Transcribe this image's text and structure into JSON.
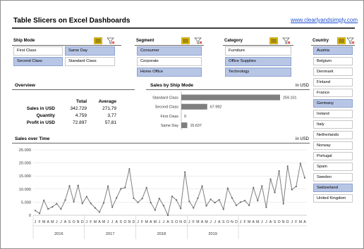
{
  "header": {
    "title": "Table Slicers on Excel Dashboards",
    "link": "www.clearlyandsimply.com"
  },
  "slicers": {
    "ship_mode": {
      "title": "Ship Mode",
      "items": [
        {
          "label": "First Class",
          "selected": false
        },
        {
          "label": "Same Day",
          "selected": true
        },
        {
          "label": "Second Class",
          "selected": true
        },
        {
          "label": "Standard Class",
          "selected": false
        }
      ]
    },
    "segment": {
      "title": "Segment",
      "items": [
        {
          "label": "Consumer",
          "selected": true
        },
        {
          "label": "Corporate",
          "selected": false
        },
        {
          "label": "Home Office",
          "selected": true
        }
      ]
    },
    "category": {
      "title": "Category",
      "items": [
        {
          "label": "Furniture",
          "selected": false
        },
        {
          "label": "Office Supplies",
          "selected": true
        },
        {
          "label": "Technology",
          "selected": true
        }
      ]
    },
    "country": {
      "title": "Country",
      "items": [
        {
          "label": "Austria",
          "selected": true
        },
        {
          "label": "Belgium",
          "selected": false
        },
        {
          "label": "Denmark",
          "selected": false
        },
        {
          "label": "Finland",
          "selected": false
        },
        {
          "label": "France",
          "selected": false
        },
        {
          "label": "Germany",
          "selected": true
        },
        {
          "label": "Ireland",
          "selected": false
        },
        {
          "label": "Italy",
          "selected": false
        },
        {
          "label": "Netherlands",
          "selected": false
        },
        {
          "label": "Norway",
          "selected": false
        },
        {
          "label": "Portugal",
          "selected": false
        },
        {
          "label": "Spain",
          "selected": false
        },
        {
          "label": "Sweden",
          "selected": false
        },
        {
          "label": "Switzerland",
          "selected": true
        },
        {
          "label": "United Kingdom",
          "selected": false
        }
      ]
    }
  },
  "overview": {
    "title": "Overview",
    "columns": [
      "Total",
      "Average"
    ],
    "rows": [
      {
        "label": "Sales in USD",
        "total": "342.729",
        "average": "271,79"
      },
      {
        "label": "Quantity",
        "total": "4.759",
        "average": "3,77"
      },
      {
        "label": "Profit in USD",
        "total": "72.897",
        "average": "57,81"
      }
    ]
  },
  "colors": {
    "selected": "#b8c6e6",
    "bar": "#7f7f7f",
    "line": "#7f7f7f",
    "link": "#1f4fd1",
    "slicer_icon": "#e8c000",
    "clear_filter": "#d9342b"
  },
  "chart_data": [
    {
      "type": "bar",
      "orientation": "horizontal",
      "title": "Sales by Ship Mode",
      "unit": "in USD",
      "categories": [
        "Standard Class",
        "Second Class",
        "First Class",
        "Same Day"
      ],
      "values": [
        259101,
        67992,
        0,
        15637
      ],
      "labels": [
        "259.101",
        "67.992",
        "0",
        "15.637"
      ]
    },
    {
      "type": "line",
      "title": "Sales over Time",
      "unit": "in USD",
      "ylim": [
        0,
        25000
      ],
      "yticks": [
        "0",
        "5.000",
        "10.000",
        "15.000",
        "20.000",
        "25.000"
      ],
      "years": [
        "2016",
        "2017",
        "2018",
        "2019"
      ],
      "month_labels": [
        "J",
        "F",
        "M",
        "A",
        "M",
        "J",
        "J",
        "A",
        "S",
        "O",
        "N",
        "D"
      ],
      "values": [
        1800,
        700,
        5700,
        2400,
        3200,
        4400,
        2400,
        5800,
        11200,
        5200,
        11400,
        4500,
        7100,
        4500,
        2800,
        1200,
        4700,
        11100,
        3100,
        6600,
        10100,
        10600,
        17700,
        6500,
        4900,
        6400,
        10500,
        4800,
        2000,
        6400,
        3700,
        0,
        7200,
        5800,
        2600,
        16500,
        5300,
        2800,
        6500,
        11100,
        3600,
        6100,
        4800,
        5900,
        2300,
        10300,
        6600,
        3800,
        5000,
        5600,
        3800,
        10500,
        5600,
        11200,
        3000,
        13800,
        8700,
        16900,
        4400,
        18700,
        9800,
        11000,
        19800,
        14300
      ]
    }
  ]
}
